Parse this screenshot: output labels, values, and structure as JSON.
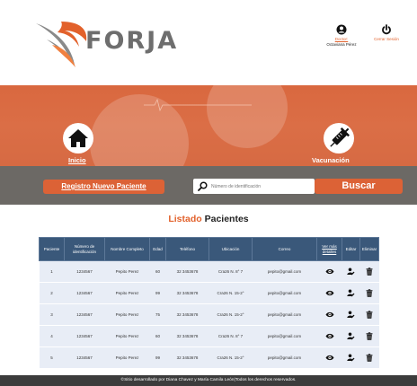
{
  "brand": {
    "name": "FORJA",
    "accent": "#e2612b",
    "dark": "#3a587a"
  },
  "header": {
    "user_label": "Doctor:",
    "user_name": "Octaviana Pérez",
    "logout_label": "Cerrar Sesión",
    "user_icon": "user-circle-icon",
    "logout_icon": "power-icon"
  },
  "nav": {
    "home_label": "Inicio",
    "home_icon": "home-icon",
    "vaccination_label": "Vacunación",
    "vaccination_icon": "syringe-icon"
  },
  "actions": {
    "register_label": "Registro Nuevo Paciente",
    "search_placeholder": "Número de identificación",
    "search_button": "Buscar"
  },
  "list": {
    "title_part1": "Listado",
    "title_part2": " Pacientes",
    "columns": [
      "Paciente",
      "Número de identificación",
      "Nombre Completo",
      "Edad",
      "Teléfono",
      "Ubicación",
      "Correo",
      "Ver más detalles",
      "Editar",
      "Eliminar"
    ],
    "rows": [
      {
        "num": "1",
        "id": "1234567",
        "name": "Pepito Perez",
        "age": "60",
        "phone": "32 3453678",
        "location": "Cra26 N. 8° 7",
        "email": "pepito@gmail.com"
      },
      {
        "num": "2",
        "id": "1234567",
        "name": "Pepito Perez",
        "age": "99",
        "phone": "32 3453678",
        "location": "Cra26 N. 15-2°",
        "email": "pepito@gmail.com"
      },
      {
        "num": "3",
        "id": "1234567",
        "name": "Pepito Perez",
        "age": "75",
        "phone": "32 3453678",
        "location": "Cra26 N. 15-2°",
        "email": "pepito@gmail.com"
      },
      {
        "num": "4",
        "id": "1234567",
        "name": "Pepito Perez",
        "age": "60",
        "phone": "32 3453678",
        "location": "Cra26 N. 8° 7",
        "email": "pepito@gmail.com"
      },
      {
        "num": "5",
        "id": "1234567",
        "name": "Pepito Perez",
        "age": "99",
        "phone": "32 3453678",
        "location": "Cra26 N. 15-2°",
        "email": "pepito@gmail.com"
      }
    ],
    "row_icons": {
      "view": "eye-icon",
      "edit": "user-edit-icon",
      "delete": "trash-icon"
    }
  },
  "footer": {
    "text": "©Sitio desarrollado por Diana Chavez y María Camila León|Todos los derechos reservados."
  }
}
